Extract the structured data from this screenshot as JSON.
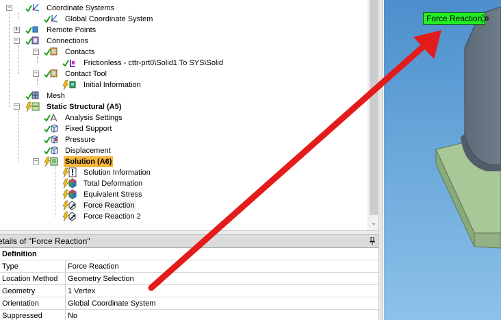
{
  "tree": {
    "items": [
      {
        "label": "Coordinate Systems"
      },
      {
        "label": "Global Coordinate System"
      },
      {
        "label": "Remote Points"
      },
      {
        "label": "Connections"
      },
      {
        "label": "Contacts"
      },
      {
        "label": "Frictionless - cttr-prt0\\Solid1 To SYS\\Solid"
      },
      {
        "label": "Contact Tool"
      },
      {
        "label": "Initial Information"
      },
      {
        "label": "Mesh"
      },
      {
        "label": "Static Structural (A5)"
      },
      {
        "label": "Analysis Settings"
      },
      {
        "label": "Fixed Support"
      },
      {
        "label": "Pressure"
      },
      {
        "label": "Displacement"
      },
      {
        "label": "Solution (A6)"
      },
      {
        "label": "Solution Information"
      },
      {
        "label": "Total Deformation"
      },
      {
        "label": "Equivalent Stress"
      },
      {
        "label": "Force Reaction"
      },
      {
        "label": "Force Reaction 2"
      }
    ]
  },
  "details": {
    "title": "etails of \"Force Reaction\"",
    "group": "Definition",
    "rows": [
      {
        "key": "Type",
        "value": "Force Reaction"
      },
      {
        "key": "Location Method",
        "value": "Geometry Selection"
      },
      {
        "key": "Geometry",
        "value": "1 Vertex"
      },
      {
        "key": "Orientation",
        "value": "Global Coordinate System"
      },
      {
        "key": "Suppressed",
        "value": "No"
      }
    ]
  },
  "viewport": {
    "annotation_label": "Force Reaction"
  },
  "colors": {
    "highlight": "#f5b73c",
    "annotation_bg": "#22ee22",
    "arrow": "#e31b1b",
    "model_face": "#5d6b78",
    "model_base": "#9fbf8f",
    "viewport_bg": "#5f9fd3"
  },
  "icons": {
    "check": "green-check-icon",
    "lightning": "lightning-bolt-icon",
    "pin": "pin-icon",
    "scroll_down": "chevron-down-icon"
  }
}
